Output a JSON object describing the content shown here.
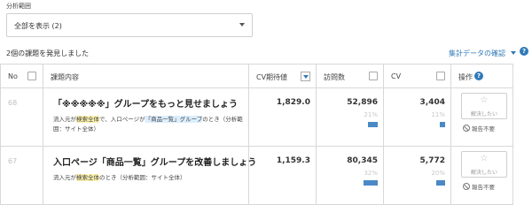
{
  "filter": {
    "label": "分析範囲",
    "selected": "全部を表示 (2)"
  },
  "summary": {
    "found_text": "2個の課題を発見しました",
    "confirm_link": "集計データの確認",
    "help": "?"
  },
  "table": {
    "headers": {
      "no": "No",
      "content": "課題内容",
      "cv_expect": "CV期待値",
      "visits": "訪問数",
      "cv": "CV",
      "action": "操作",
      "action_help": "?"
    },
    "rows": [
      {
        "no": "68",
        "title": "「※※※※※」グループをもっと見せましょう",
        "desc_pre": "流入元が",
        "desc_tag1": "検索全体",
        "desc_mid": "で、入口ページが",
        "desc_tag2": "「商品一覧」グループ",
        "desc_post": "のとき（分析範囲：サイト全体）",
        "cv_expect": "1,829.0",
        "visits": "52,896",
        "visits_pct": "21%",
        "visits_share": 0.21,
        "cv": "3,404",
        "cv_pct": "11%",
        "cv_share": 0.11,
        "fav_label": "解決したい",
        "nope_label": "報告不要"
      },
      {
        "no": "67",
        "title": "入口ページ「商品一覧」グループを改善しましょう",
        "desc_pre": "流入元が",
        "desc_tag1": "検索全体",
        "desc_mid": "のとき（分析範囲：サイト全体）",
        "cv_expect": "1,159.3",
        "visits": "80,345",
        "visits_pct": "32%",
        "visits_share": 0.32,
        "cv": "5,772",
        "cv_pct": "20%",
        "cv_share": 0.2,
        "fav_label": "解決したい",
        "nope_label": "報告不要"
      }
    ]
  },
  "colors": {
    "accent": "#2f7ab8",
    "bar": "#4a89c5",
    "highlight_yellow": "#fdf3b0",
    "highlight_blue": "#dbeefe"
  },
  "icons": [
    "chevron-down-icon",
    "help-icon",
    "sort-icon",
    "star-icon",
    "no-entry-icon"
  ]
}
